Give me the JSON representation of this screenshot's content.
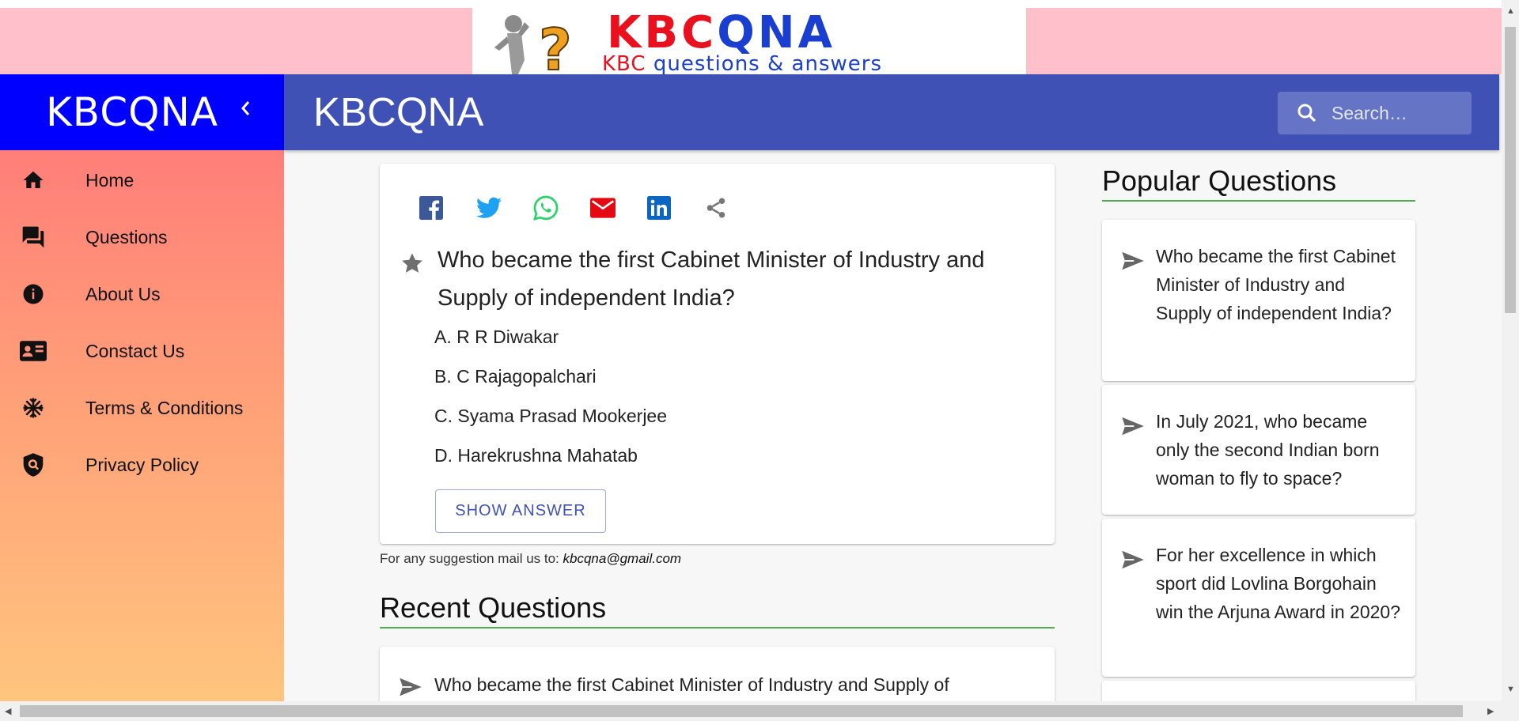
{
  "banner": {
    "logo_title_red": "KBC",
    "logo_title_blue": "QNA",
    "logo_sub_red": "KBC",
    "logo_sub_blue": " questions & answers"
  },
  "sidebar": {
    "brand": "KBCQNA",
    "collapse_icon": "chevron-left-icon",
    "items": [
      {
        "label": "Home",
        "icon": "home-icon"
      },
      {
        "label": "Questions",
        "icon": "forum-icon"
      },
      {
        "label": "About Us",
        "icon": "info-icon"
      },
      {
        "label": "Constact Us",
        "icon": "contact-card-icon"
      },
      {
        "label": "Terms & Conditions",
        "icon": "snowflake-icon"
      },
      {
        "label": "Privacy Policy",
        "icon": "shield-search-icon"
      }
    ]
  },
  "appbar": {
    "title": "KBCQNA",
    "search_placeholder": "Search…"
  },
  "question": {
    "share_icons": [
      "facebook-icon",
      "twitter-icon",
      "whatsapp-icon",
      "email-icon",
      "linkedin-icon",
      "share-icon"
    ],
    "text": "Who became the first Cabinet Minister of Industry and Supply of independent India?",
    "options": [
      "A. R R Diwakar",
      "B. C Rajagopalchari",
      "C. Syama Prasad Mookerjee",
      "D. Harekrushna Mahatab"
    ],
    "show_answer": "SHOW ANSWER"
  },
  "suggestion": {
    "prefix": "For any suggestion mail us to: ",
    "email": "kbcqna@gmail.com"
  },
  "recent": {
    "title": "Recent Questions",
    "items": [
      "Who became the first Cabinet Minister of Industry and Supply of"
    ]
  },
  "popular": {
    "title": "Popular Questions",
    "items": [
      "Who became the first Cabinet Minister of Industry and Supply of independent India?",
      "In July 2021, who became only the second Indian born woman to fly to space?",
      "For her excellence in which sport did Lovlina Borgohain win the Arjuna Award in 2020?"
    ]
  },
  "colors": {
    "banner_bg": "#ffc0cb",
    "sidebar_header": "#0000ff",
    "appbar": "#3f51b5",
    "accent_green": "#4caf50"
  }
}
